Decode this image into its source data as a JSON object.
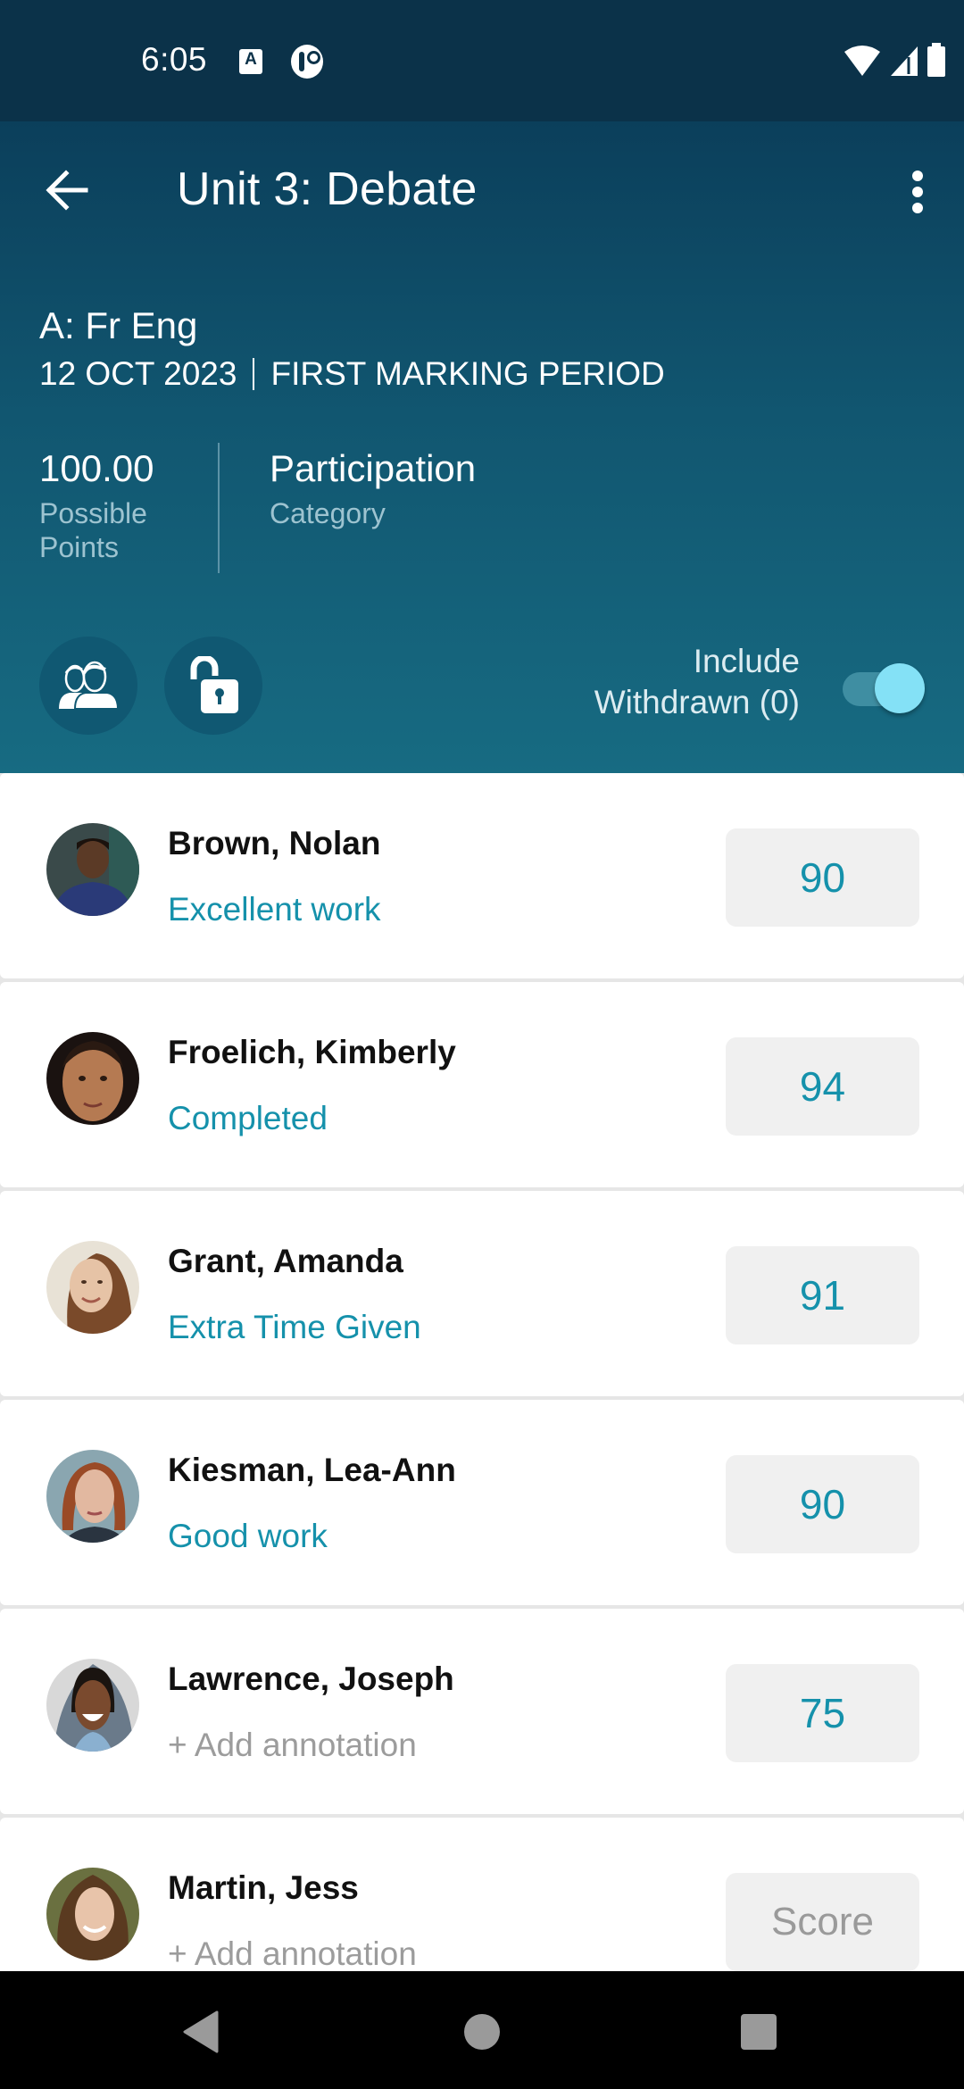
{
  "status_bar": {
    "time": "6:05",
    "notification_icons": [
      "accessibility-a-icon",
      "app-notification-icon"
    ],
    "system_icons": [
      "wifi-icon",
      "signal-icon",
      "battery-icon"
    ]
  },
  "header": {
    "title": "Unit 3: Debate",
    "back_icon": "arrow-left-icon",
    "menu_icon": "more-vertical-icon",
    "class_name": "A: Fr Eng",
    "date": "12 OCT 2023",
    "marking_period": "FIRST MARKING PERIOD",
    "possible_points": {
      "value": "100.00",
      "label": "Possible Points"
    },
    "category": {
      "value": "Participation",
      "label": "Category"
    },
    "actions": [
      {
        "name": "students-icon"
      },
      {
        "name": "unlock-icon"
      }
    ],
    "withdrawn": {
      "label_line1": "Include",
      "label_line2": "Withdrawn (0)",
      "enabled": true
    }
  },
  "colors": {
    "header_top": "#0b3f5b",
    "header_bottom": "#176b82",
    "accent": "#1591ab",
    "toggle_thumb": "#84e1f6"
  },
  "students": [
    {
      "name": "Brown, Nolan",
      "annotation": "Excellent work",
      "has_annotation": true,
      "score": "90"
    },
    {
      "name": "Froelich, Kimberly",
      "annotation": "Completed",
      "has_annotation": true,
      "score": "94"
    },
    {
      "name": "Grant, Amanda",
      "annotation": "Extra Time Given",
      "has_annotation": true,
      "score": "91"
    },
    {
      "name": "Kiesman, Lea-Ann",
      "annotation": "Good work",
      "has_annotation": true,
      "score": "90"
    },
    {
      "name": "Lawrence, Joseph",
      "annotation": "+ Add annotation",
      "has_annotation": false,
      "score": "75"
    },
    {
      "name": "Martin, Jess",
      "annotation": "+ Add annotation",
      "has_annotation": false,
      "score": "",
      "score_placeholder": "Score"
    }
  ],
  "nav_bar": {
    "buttons": [
      "back-triangle-icon",
      "home-circle-icon",
      "recents-square-icon"
    ]
  }
}
